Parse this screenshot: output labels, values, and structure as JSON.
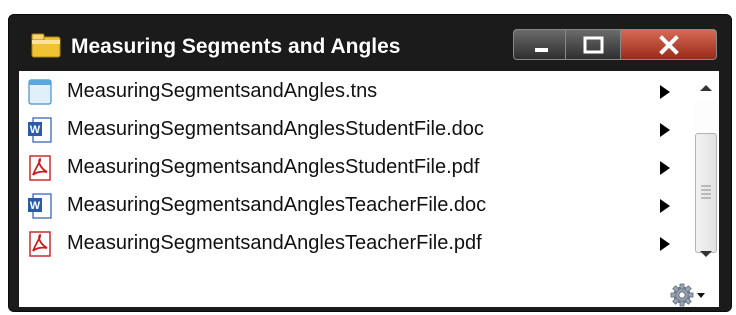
{
  "window": {
    "title": "Measuring Segments and Angles",
    "title_icon": "folder-icon",
    "controls": [
      {
        "name": "minimize-button",
        "icon": "minimize-icon"
      },
      {
        "name": "maximize-button",
        "icon": "maximize-icon"
      },
      {
        "name": "close-button",
        "icon": "close-icon"
      }
    ]
  },
  "files": [
    {
      "name": "MeasuringSegmentsandAngles.tns",
      "icon": "tns-file-icon"
    },
    {
      "name": "MeasuringSegmentsandAnglesStudentFile.doc",
      "icon": "word-file-icon"
    },
    {
      "name": "MeasuringSegmentsandAnglesStudentFile.pdf",
      "icon": "pdf-file-icon"
    },
    {
      "name": "MeasuringSegmentsandAnglesTeacherFile.doc",
      "icon": "word-file-icon"
    },
    {
      "name": "MeasuringSegmentsandAnglesTeacherFile.pdf",
      "icon": "pdf-file-icon"
    }
  ],
  "toolbar": {
    "settings_icon": "gear-icon"
  },
  "colors": {
    "window_frame": "#1b1b1b",
    "close_button": "#c0432f",
    "pdf_red": "#c21f1f",
    "word_blue": "#2b5aa8"
  }
}
